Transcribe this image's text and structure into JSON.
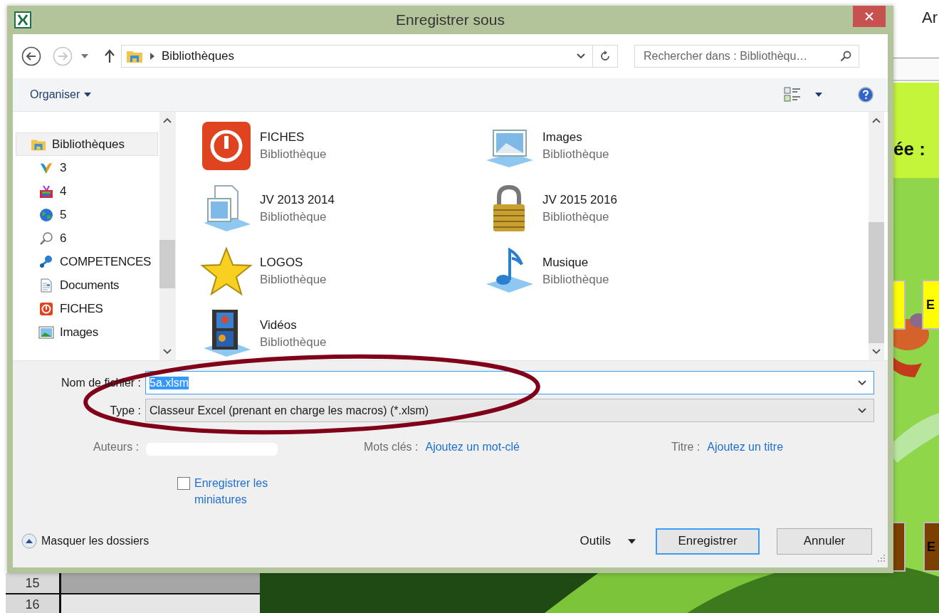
{
  "window": {
    "title": "Enregistrer sous"
  },
  "navigation": {
    "back_enabled": true,
    "forward_enabled": false,
    "path": [
      "Bibliothèques"
    ],
    "search": {
      "placeholder": "Rechercher dans : Bibliothèqu…"
    }
  },
  "toolbar": {
    "organize": "Organiser"
  },
  "sidebar": {
    "items": [
      {
        "label": "Bibliothèques",
        "selected": true,
        "children": [
          {
            "label": "3",
            "selected": false
          },
          {
            "label": "4",
            "selected": false
          },
          {
            "label": "5",
            "selected": false
          },
          {
            "label": "6",
            "selected": false
          },
          {
            "label": "COMPETENCES",
            "selected": false
          },
          {
            "label": "Documents",
            "selected": false
          },
          {
            "label": "FICHES",
            "selected": false
          },
          {
            "label": "Images",
            "selected": false
          }
        ]
      }
    ]
  },
  "libraries": [
    {
      "name": "FICHES",
      "type": "Bibliothèque"
    },
    {
      "name": "Images",
      "type": "Bibliothèque"
    },
    {
      "name": "JV 2013 2014",
      "type": "Bibliothèque"
    },
    {
      "name": "JV 2015 2016",
      "type": "Bibliothèque"
    },
    {
      "name": "LOGOS",
      "type": "Bibliothèque"
    },
    {
      "name": "Musique",
      "type": "Bibliothèque"
    },
    {
      "name": "Vidéos",
      "type": "Bibliothèque"
    }
  ],
  "form": {
    "filename": {
      "label": "Nom de fichier :",
      "value": "5a.xlsm",
      "text_selected": true
    },
    "filetype": {
      "label": "Type :",
      "value": "Classeur Excel (prenant en charge les macros) (*.xlsm)"
    },
    "meta": [
      {
        "label": "Auteurs :",
        "redacted": true
      },
      {
        "label": "Mots clés :",
        "link": "Ajoutez un mot-clé"
      },
      {
        "label": "Titre :",
        "link": "Ajoutez un titre"
      }
    ],
    "thumbnails": {
      "label": "Enregistrer les miniatures",
      "checked": false
    }
  },
  "footer": {
    "toggle": "Masquer les dossiers",
    "tools": "Outils",
    "buttons": [
      {
        "label": "Enregistrer",
        "default": true
      },
      {
        "label": "Annuler",
        "default": false
      }
    ]
  },
  "annotation": {
    "kind": "ellipse",
    "color": "#80001a"
  },
  "sheet": {
    "header": "Ar",
    "banner": "ée :",
    "buttons": [
      {
        "color": "#ffff00"
      },
      {
        "label": "E",
        "color": "#ffff00"
      },
      {
        "color": "#7b3f00"
      },
      {
        "label": "E",
        "color": "#7b3f00"
      }
    ],
    "row_numbers": [
      "15",
      "16"
    ]
  }
}
